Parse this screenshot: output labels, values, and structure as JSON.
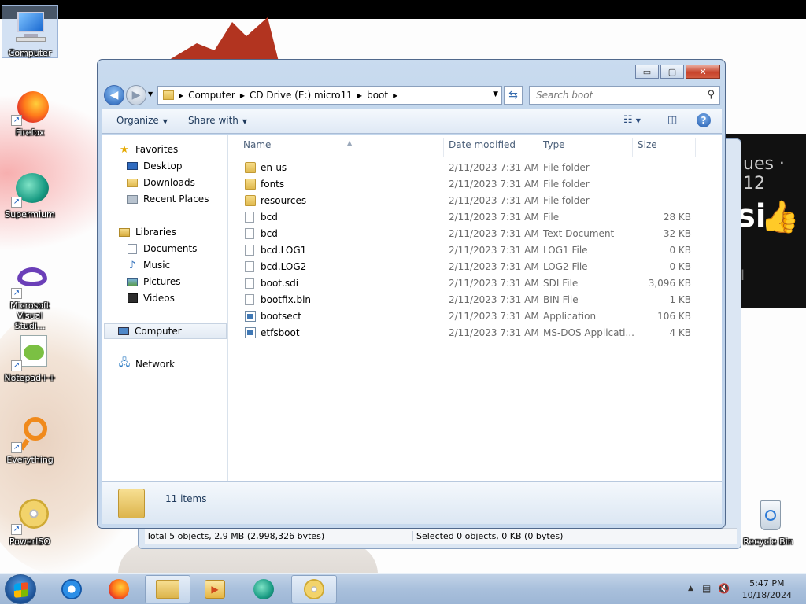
{
  "desktop": {
    "icons": [
      {
        "label": "Computer"
      },
      {
        "label": "Firefox"
      },
      {
        "label": "Supermium"
      },
      {
        "label": "Microsoft Visual Studi..."
      },
      {
        "label": "Notepad++"
      },
      {
        "label": "Everything"
      },
      {
        "label": "PowerISO"
      },
      {
        "label": "Recycle Bin"
      }
    ],
    "bg_text": {
      "line1": "ues · 12",
      "line2": "si",
      "line3": "il"
    }
  },
  "explorer": {
    "caption_buttons": {
      "minimize": "▭",
      "maximize": "▢",
      "close": "✕"
    },
    "address": {
      "segments": [
        "Computer",
        "CD Drive (E:) micro11",
        "boot"
      ]
    },
    "search": {
      "placeholder": "Search boot"
    },
    "toolbar": {
      "organize": "Organize",
      "share_with": "Share with"
    },
    "nav": {
      "favorites": "Favorites",
      "favorites_items": [
        "Desktop",
        "Downloads",
        "Recent Places"
      ],
      "libraries": "Libraries",
      "libraries_items": [
        "Documents",
        "Music",
        "Pictures",
        "Videos"
      ],
      "computer": "Computer",
      "network": "Network"
    },
    "columns": {
      "name": "Name",
      "date": "Date modified",
      "type": "Type",
      "size": "Size"
    },
    "files": [
      {
        "name": "en-us",
        "date": "2/11/2023 7:31 AM",
        "type": "File folder",
        "size": "",
        "kind": "folder"
      },
      {
        "name": "fonts",
        "date": "2/11/2023 7:31 AM",
        "type": "File folder",
        "size": "",
        "kind": "folder"
      },
      {
        "name": "resources",
        "date": "2/11/2023 7:31 AM",
        "type": "File folder",
        "size": "",
        "kind": "folder"
      },
      {
        "name": "bcd",
        "date": "2/11/2023 7:31 AM",
        "type": "File",
        "size": "28 KB",
        "kind": "file"
      },
      {
        "name": "bcd",
        "date": "2/11/2023 7:31 AM",
        "type": "Text Document",
        "size": "32 KB",
        "kind": "file"
      },
      {
        "name": "bcd.LOG1",
        "date": "2/11/2023 7:31 AM",
        "type": "LOG1 File",
        "size": "0 KB",
        "kind": "file"
      },
      {
        "name": "bcd.LOG2",
        "date": "2/11/2023 7:31 AM",
        "type": "LOG2 File",
        "size": "0 KB",
        "kind": "file"
      },
      {
        "name": "boot.sdi",
        "date": "2/11/2023 7:31 AM",
        "type": "SDI File",
        "size": "3,096 KB",
        "kind": "file"
      },
      {
        "name": "bootfix.bin",
        "date": "2/11/2023 7:31 AM",
        "type": "BIN File",
        "size": "1 KB",
        "kind": "file"
      },
      {
        "name": "bootsect",
        "date": "2/11/2023 7:31 AM",
        "type": "Application",
        "size": "106 KB",
        "kind": "app"
      },
      {
        "name": "etfsboot",
        "date": "2/11/2023 7:31 AM",
        "type": "MS-DOS Applicati...",
        "size": "4 KB",
        "kind": "app"
      }
    ],
    "details": {
      "item_count": "11 items"
    }
  },
  "background_window": {
    "status_left": "Total 5 objects, 2.9 MB (2,998,326 bytes)",
    "status_right": "Selected 0 objects, 0 KB (0 bytes)"
  },
  "taskbar": {
    "clock_time": "5:47 PM",
    "clock_date": "10/18/2024"
  }
}
